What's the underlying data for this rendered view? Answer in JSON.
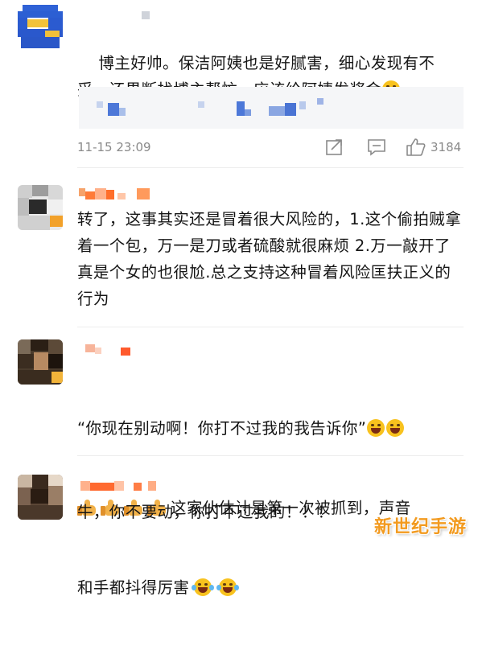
{
  "comments": [
    {
      "text": "博主好帅。保洁阿姨也是好腻害，细心发现有不妥，还果断找博主帮忙，应该给阿姨发奖金",
      "emoji": "crying-face-emoji",
      "timestamp": "11-15 23:09",
      "like_count": "3184"
    },
    {
      "text": "转了，这事其实还是冒着很大风险的，1.这个偷拍贼拿着一个包，万一是刀或者硫酸就很麻烦 2.万一敲开了真是个女的也很尬.总之支持这种冒着风险匡扶正义的行为"
    },
    {
      "line1": "“你现在别动啊！你打不过我的我告诉你”",
      "line2": "这家伙估计是第一次被抓到，声音",
      "line3": "和手都抖得厉害"
    },
    {
      "text": "牛，你不要动，你打不过我的！！！"
    }
  ],
  "watermark": "新世纪手游",
  "colors": {
    "text": "#151515",
    "meta": "#8a8a8a",
    "watermark": "#f29a1f",
    "emoji": "#f8c21e"
  }
}
